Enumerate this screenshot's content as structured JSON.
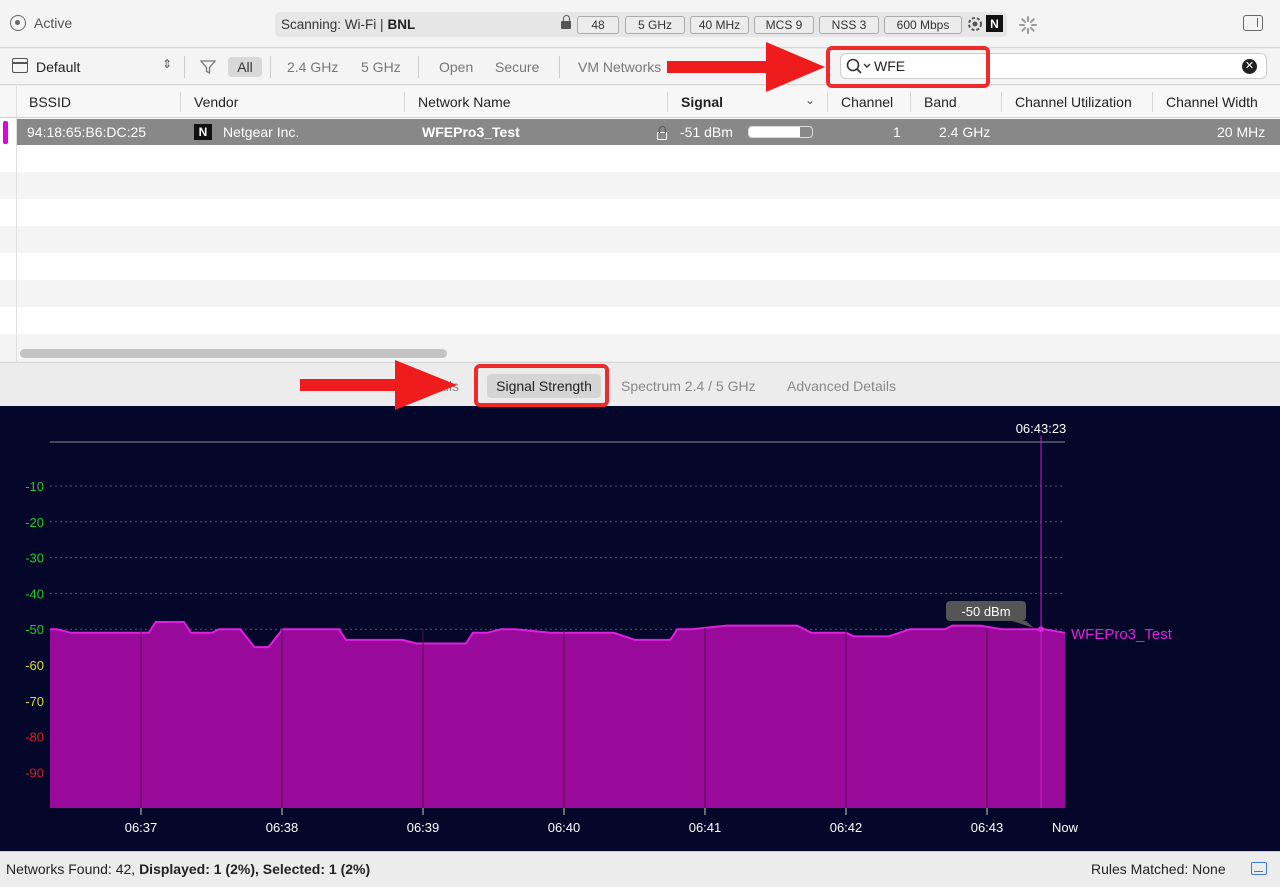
{
  "toolbar": {
    "active_label": "Active",
    "scan_prefix": "Scanning: Wi-Fi  |",
    "scan_ssid": "BNL",
    "pills": [
      "48",
      "5 GHz",
      "40 MHz",
      "MCS 9",
      "NSS 3",
      "600 Mbps"
    ],
    "vendor_logo": "N"
  },
  "filter": {
    "profile": "Default",
    "options": [
      "All",
      "2.4 GHz",
      "5 GHz",
      "Open",
      "Secure",
      "VM Networks"
    ],
    "search_value": "WFE"
  },
  "table": {
    "columns": [
      "BSSID",
      "Vendor",
      "Network Name",
      "Signal",
      "Channel",
      "Band",
      "Channel Utilization",
      "Channel Width"
    ],
    "rows": [
      {
        "bssid": "94:18:65:B6:DC:25",
        "vendor_logo": "N",
        "vendor": "Netgear Inc.",
        "network_name": "WFEPro3_Test",
        "signal": "-51 dBm",
        "signal_level": 0.8,
        "channel": "1",
        "band": "2.4 GHz",
        "channel_width": "20 MHz"
      }
    ]
  },
  "tabs": {
    "details_fragment": "ails",
    "signal_strength": "Signal Strength",
    "spectrum": "Spectrum 2.4 / 5 GHz",
    "advanced": "Advanced Details"
  },
  "chart_data": {
    "type": "area",
    "title": "",
    "xlabel": "",
    "ylabel": "",
    "ylim": [
      -100,
      0
    ],
    "yticks": [
      -10,
      -20,
      -30,
      -40,
      -50,
      -60,
      -70,
      -80,
      -90
    ],
    "ytick_colors": {
      "-10": "#22cc22",
      "-20": "#22cc22",
      "-30": "#22cc22",
      "-40": "#22cc22",
      "-50": "#22cc22",
      "-60": "#dddd33",
      "-70": "#dddd33",
      "-80": "#dd2222",
      "-90": "#dd2222"
    },
    "xticks": [
      "06:37",
      "06:38",
      "06:39",
      "06:40",
      "06:41",
      "06:42",
      "06:43",
      "Now"
    ],
    "grid": true,
    "cursor_time": "06:43:23",
    "cursor_value_label": "-50 dBm",
    "series": [
      {
        "name": "WFEPro3_Test",
        "color": "#e020e0",
        "fill": "#9a0a9a",
        "x_minutes": [
          0.0,
          0.1,
          0.3,
          0.9,
          1.0,
          1.2,
          1.4,
          1.5,
          1.9,
          2.0,
          2.3,
          2.4,
          2.7,
          2.9,
          3.1,
          3.3,
          3.8,
          4.1,
          4.2,
          4.4,
          4.6,
          5.0,
          5.2,
          5.9,
          6.0,
          6.2,
          6.4,
          6.6,
          7.1,
          7.3,
          7.7,
          8.0,
          8.3,
          8.8,
          8.9,
          9.1,
          9.6,
          9.9,
          10.2,
          10.6,
          10.8,
          11.3,
          11.4,
          11.6,
          11.9,
          12.2,
          12.7,
          12.8,
          13.2,
          13.5,
          13.9,
          14.1,
          14.4
        ],
        "values": [
          -50,
          -50,
          -51,
          -51,
          -51,
          -51,
          -51,
          -48,
          -48,
          -51,
          -51,
          -50,
          -50,
          -55,
          -55,
          -50,
          -50,
          -50,
          -53,
          -53,
          -53,
          -53,
          -54,
          -54,
          -51,
          -51,
          -50,
          -50,
          -51,
          -51,
          -51,
          -51,
          -53,
          -53,
          -50,
          -50,
          -49,
          -49,
          -49,
          -49,
          -51,
          -51,
          -52,
          -52,
          -52,
          -50,
          -50,
          -49,
          -49,
          -50,
          -50,
          -50,
          -51
        ]
      }
    ]
  },
  "status": {
    "networks_found_label": "Networks Found: 42,",
    "displayed": "Displayed: 1 (2%), Selected: 1 (2%)",
    "rules": "Rules Matched: None"
  }
}
